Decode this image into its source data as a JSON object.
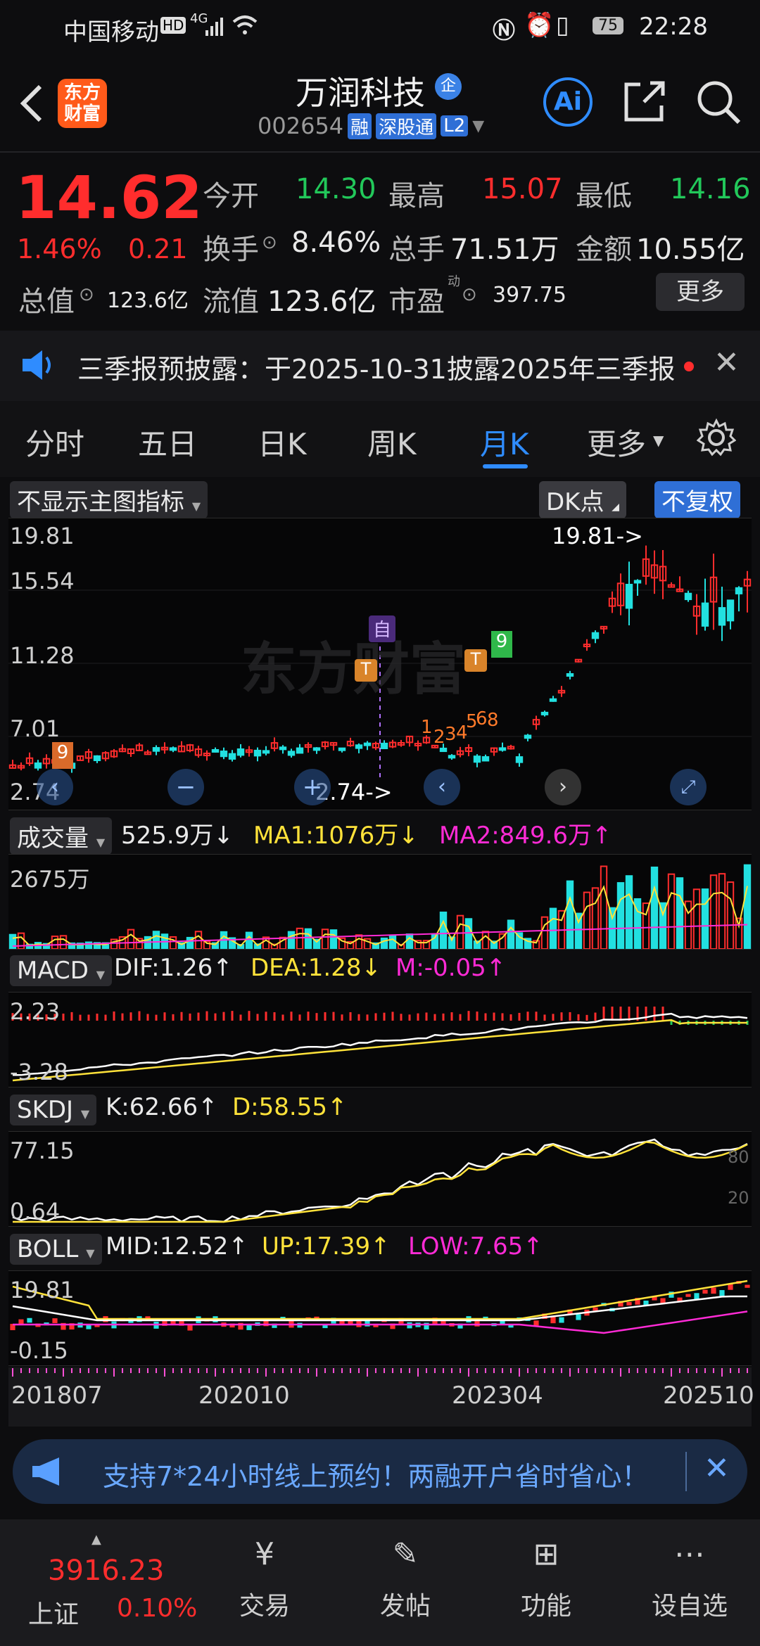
{
  "status": {
    "carrier": "中国移动",
    "hd": "HD",
    "net": "4G",
    "battery": "75",
    "time": "22:28"
  },
  "header": {
    "logo_line1": "东方",
    "logo_line2": "财富",
    "stock_name": "万润科技",
    "name_badge": "企",
    "code": "002654",
    "tags": [
      "融",
      "深股通",
      "L2"
    ],
    "ai_label": "Ai"
  },
  "quote": {
    "price": "14.62",
    "change_pct": "1.46%",
    "change": "0.21",
    "open_label": "今开",
    "open": "14.30",
    "high_label": "最高",
    "high": "15.07",
    "low_label": "最低",
    "low": "14.16",
    "turnover_label": "换手",
    "turnover": "8.46%",
    "volume_label": "总手",
    "volume": "71.51万",
    "amount_label": "金额",
    "amount": "10.55亿",
    "mktcap_label": "总值",
    "mktcap": "123.6亿",
    "float_label": "流值",
    "float": "123.6亿",
    "pe_label": "市盈",
    "pe_sup": "动",
    "pe": "397.75",
    "more_label": "更多"
  },
  "notice": {
    "text": "三季报预披露：于2025-10-31披露2025年三季报"
  },
  "tabs": {
    "items": [
      "分时",
      "五日",
      "日K",
      "周K",
      "月K",
      "更多"
    ],
    "active": "月K"
  },
  "chart_header": {
    "indicator_select": "不显示主图指标",
    "dk_label": "DK点",
    "adjust_label": "不复权"
  },
  "chart_data": {
    "type": "candlestick",
    "period": "monthly",
    "y_ticks": [
      "19.81",
      "15.54",
      "11.28",
      "7.01",
      "2.74"
    ],
    "max_marker": "19.81->",
    "min_marker": "2.74->",
    "x_ticks": [
      "201807",
      "202010",
      "202304",
      "202510"
    ],
    "signal_marks": [
      "9",
      "1",
      "2",
      "3",
      "4",
      "5",
      "6",
      "8",
      "9",
      "T",
      "T",
      "自"
    ],
    "volume": {
      "label": "成交量",
      "value": "525.9万",
      "ma1": "MA1:1076万",
      "ma2": "MA2:849.6万",
      "tick": "2675万"
    },
    "macd": {
      "label": "MACD",
      "dif": "DIF:1.26",
      "dea": "DEA:1.28",
      "m": "M:-0.05",
      "ticks": [
        "2.23",
        "-3.28"
      ]
    },
    "skdj": {
      "label": "SKDJ",
      "k": "K:62.66",
      "d": "D:58.55",
      "ticks": [
        "77.15",
        "0.64"
      ],
      "levels": [
        "80",
        "20"
      ]
    },
    "boll": {
      "label": "BOLL",
      "mid": "MID:12.52",
      "up": "UP:17.39",
      "low": "LOW:7.65",
      "ticks": [
        "19.81",
        "-0.15"
      ]
    }
  },
  "banner": {
    "text": "支持7*24小时线上预约！两融开户省时省心！"
  },
  "bottom_nav": {
    "index_value": "3916.23",
    "index_name": "上证",
    "index_change": "0.10%",
    "items": [
      "交易",
      "发帖",
      "功能",
      "设自选"
    ]
  },
  "colors": {
    "up": "#ff2d2d",
    "down": "#22e0e0",
    "accent": "#2f8cff"
  }
}
